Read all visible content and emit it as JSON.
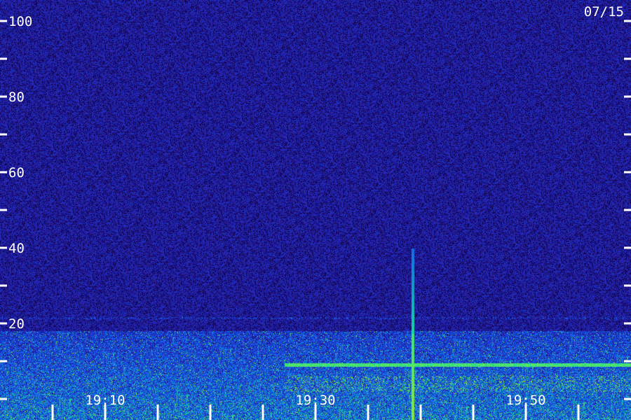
{
  "chart_data": {
    "type": "heatmap",
    "date_label": "07/15",
    "y_ticks": [
      0,
      10,
      20,
      30,
      40,
      50,
      60,
      70,
      80,
      90,
      100
    ],
    "y_tick_labels": [
      {
        "value": 20,
        "label": "20"
      },
      {
        "value": 40,
        "label": "40"
      },
      {
        "value": 60,
        "label": "60"
      },
      {
        "value": 80,
        "label": "80"
      },
      {
        "value": 100,
        "label": "100"
      }
    ],
    "ylim": [
      0,
      100
    ],
    "x_ticks_minutes": [
      5,
      10,
      15,
      20,
      25,
      30,
      35,
      40,
      45,
      50,
      55
    ],
    "x_tick_labels": [
      {
        "value": 10,
        "label": "19:10"
      },
      {
        "value": 30,
        "label": "19:30"
      },
      {
        "value": 50,
        "label": "19:50"
      }
    ],
    "xlim_minutes": [
      0,
      60
    ],
    "features": {
      "noise_floor_color": "#2a1580",
      "band_low_top": 18,
      "strong_band_start_minute": 27,
      "spike_minute": 39.2,
      "spike_top": 30
    },
    "colors": {
      "background": "#1e0f6e",
      "low": "#3a20b0",
      "mid": "#2e7cff",
      "high": "#27d9a0",
      "peak": "#9dff3a",
      "axis": "#ffffff"
    }
  }
}
